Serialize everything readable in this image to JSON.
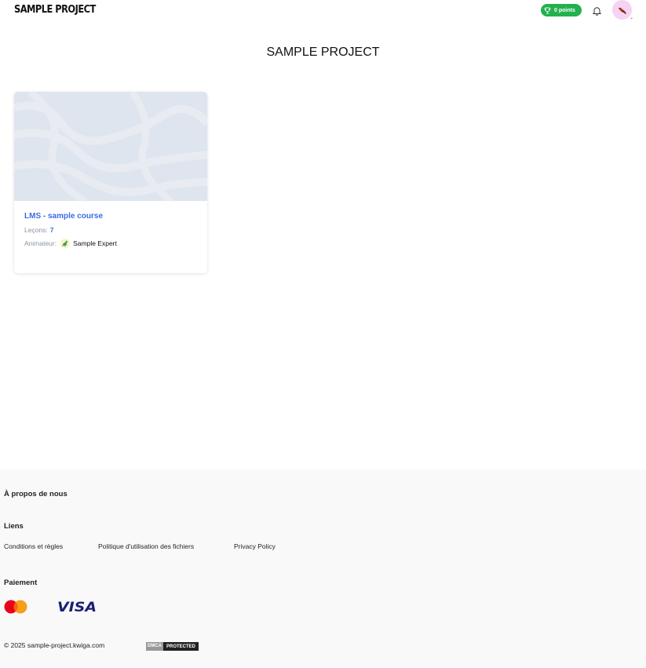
{
  "header": {
    "brand": "SAMPLE PROJECT",
    "points_label": "0 points",
    "icons": {
      "points": "trophy-icon",
      "notifications": "bell-icon",
      "avatar": "bird-avatar-icon",
      "menu": "chevron-down-icon"
    }
  },
  "main": {
    "title": "SAMPLE PROJECT",
    "course": {
      "title": "LMS - sample course",
      "lessons_label": "Leçons:",
      "lessons_count": "7",
      "host_label": "Animateur:",
      "host_name": "Sample Expert"
    }
  },
  "footer": {
    "about": "À propos de nous",
    "links_heading": "Liens",
    "links": [
      "Conditions et règles",
      "Politique d'utilisation des fichiers",
      "Privacy Policy"
    ],
    "payment_heading": "Paiement",
    "payment_methods": [
      "mastercard-icon",
      "visa-icon"
    ],
    "copyright": "© 2025 sample-project.kwiga.com",
    "dmca": [
      "DMCA",
      "PROTECTED"
    ]
  },
  "colors": {
    "accent": "#3a6de3",
    "points_badge": "#22b14c",
    "cover": "#dfe5ee",
    "footer_bg": "#f9f9f9",
    "avatar_bg": "#f6d3f2"
  }
}
